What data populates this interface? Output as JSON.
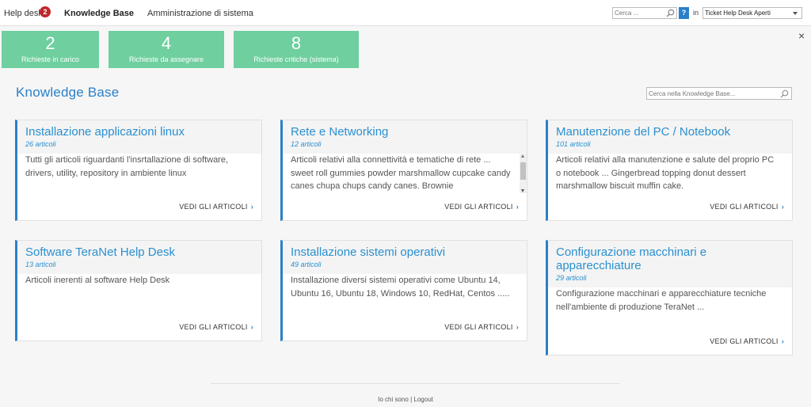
{
  "topnav": {
    "helpdesk_label": "Help desk",
    "helpdesk_badge": "2",
    "kb_label": "Knowledge Base",
    "admin_label": "Amministrazione di sistema",
    "search_placeholder": "Cerca ...",
    "help_label": "?",
    "in_label": "in",
    "scope_selected": "Ticket Help Desk Aperti"
  },
  "stats": [
    {
      "value": "2",
      "label": "Richieste in carico"
    },
    {
      "value": "4",
      "label": "Richieste da assegnare"
    },
    {
      "value": "8",
      "label": "Richieste critiche (sistema)"
    }
  ],
  "close_label": "×",
  "kb": {
    "title": "Knowledge Base",
    "search_placeholder": "Cerca nella Knowledge Base..."
  },
  "cards": [
    {
      "title": "Installazione applicazioni linux",
      "count": "26 articoli",
      "desc": "Tutti gli articoli riguardanti l'insrtallazione di software, drivers, utility, repository in ambiente linux",
      "link": "VEDI GLI ARTICOLI"
    },
    {
      "title": "Rete e Networking",
      "count": "12 articoli",
      "desc": "Articoli relativi alla connettività e tematiche di rete ... sweet roll gummies powder marshmallow cupcake candy canes chupa chups candy canes. Brownie",
      "link": "VEDI GLI ARTICOLI"
    },
    {
      "title": "Manutenzione del PC / Notebook",
      "count": "101 articoli",
      "desc": "Articoli relativi alla manutenzione e salute del proprio PC o notebook ... Gingerbread topping donut dessert marshmallow biscuit muffin cake.",
      "link": "VEDI GLI ARTICOLI"
    },
    {
      "title": "Software TeraNet Help Desk",
      "count": "13 articoli",
      "desc": "Articoli inerenti al software Help Desk",
      "link": "VEDI GLI ARTICOLI"
    },
    {
      "title": "Installazione sistemi operativi",
      "count": "49 articoli",
      "desc": "Installazione diversi sistemi operativi come Ubuntu 14, Ubuntu 16, Ubuntu 18, Windows 10, RedHat, Centos .....",
      "link": "VEDI GLI ARTICOLI"
    },
    {
      "title": "Configurazione macchinari e apparecchiature",
      "count": "29 articoli",
      "desc": "Configurazione macchinari e apparecchiature tecniche nell'ambiente di produzione TeraNet ...",
      "link": "VEDI GLI ARTICOLI"
    }
  ],
  "footer": {
    "about": "Io chi sono",
    "separator": "|",
    "logout": "Logout"
  }
}
